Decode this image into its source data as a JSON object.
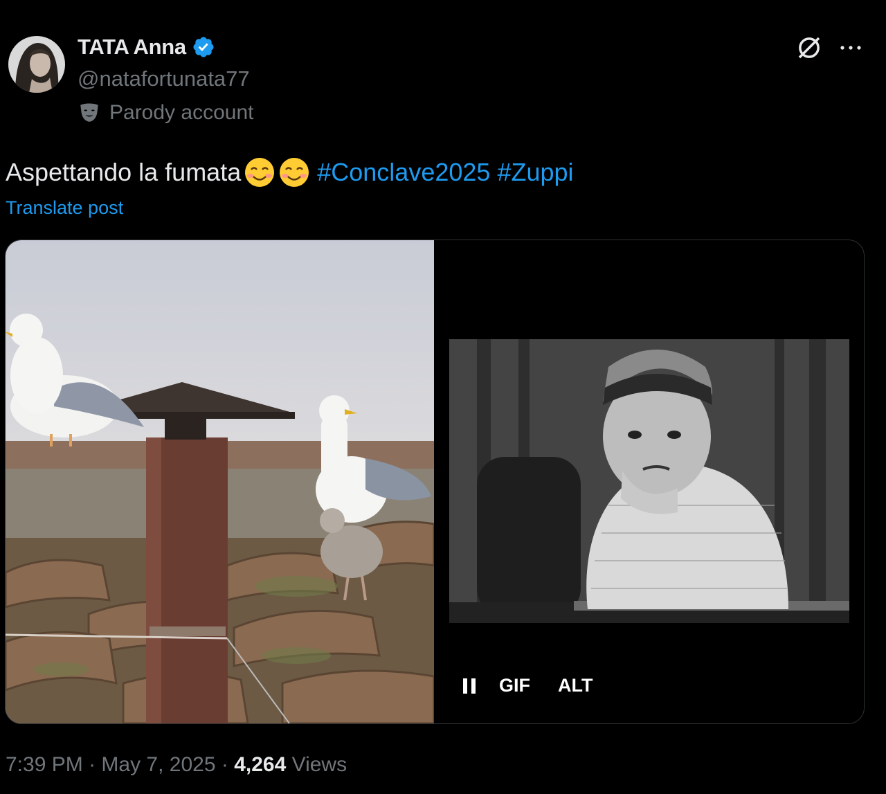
{
  "author": {
    "display_name": "TATA Anna",
    "handle": "@natafortunata77",
    "verified_icon": "verified-badge-icon",
    "verified_color": "#1d9bf0",
    "parody_label": "Parody account",
    "parody_icon": "theater-mask-icon"
  },
  "actions": {
    "grok_icon": "grok-icon",
    "more_icon": "more-dots-icon"
  },
  "post": {
    "text": "Aspettando la fumata",
    "emojis": [
      "😊",
      "😊"
    ],
    "hashtags": [
      "#Conclave2025",
      "#Zuppi"
    ],
    "translate_label": "Translate post",
    "link_color": "#1d9bf0"
  },
  "media": {
    "gif_label": "GIF",
    "alt_label": "ALT",
    "pause_icon": "pause-icon"
  },
  "meta": {
    "time": "7:39 PM",
    "separator": " · ",
    "date": "May 7, 2025",
    "views_count": "4,264",
    "views_label": "Views"
  }
}
